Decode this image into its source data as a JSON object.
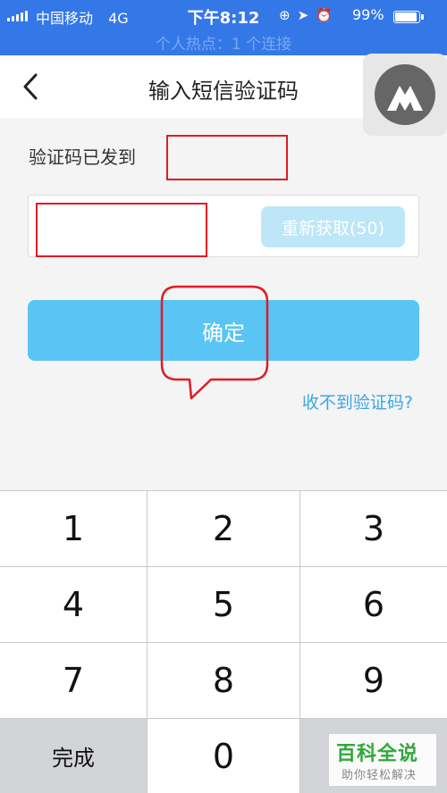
{
  "status_bar": {
    "carrier": "中国移动",
    "network": "4G",
    "time": "下午8:12",
    "battery": "99%",
    "hotspot_banner": "个人热点：1 个连接"
  },
  "header": {
    "title": "输入短信验证码"
  },
  "content": {
    "sent_label": "验证码已发到",
    "resend_label": "重新获取(50)",
    "confirm_label": "确定",
    "no_code_link": "收不到验证码?"
  },
  "keypad": {
    "keys": [
      "1",
      "2",
      "3",
      "4",
      "5",
      "6",
      "7",
      "8",
      "9"
    ],
    "done_label": "完成",
    "zero_label": "0"
  },
  "watermark": {
    "title": "百科全说",
    "subtitle": "助你轻松解决"
  },
  "colors": {
    "status_bar": "#3478e8",
    "confirm_button": "#5ac4f5",
    "resend_button": "#bde6f8",
    "link": "#3ba7e2",
    "annotation_red": "#e01c24"
  }
}
